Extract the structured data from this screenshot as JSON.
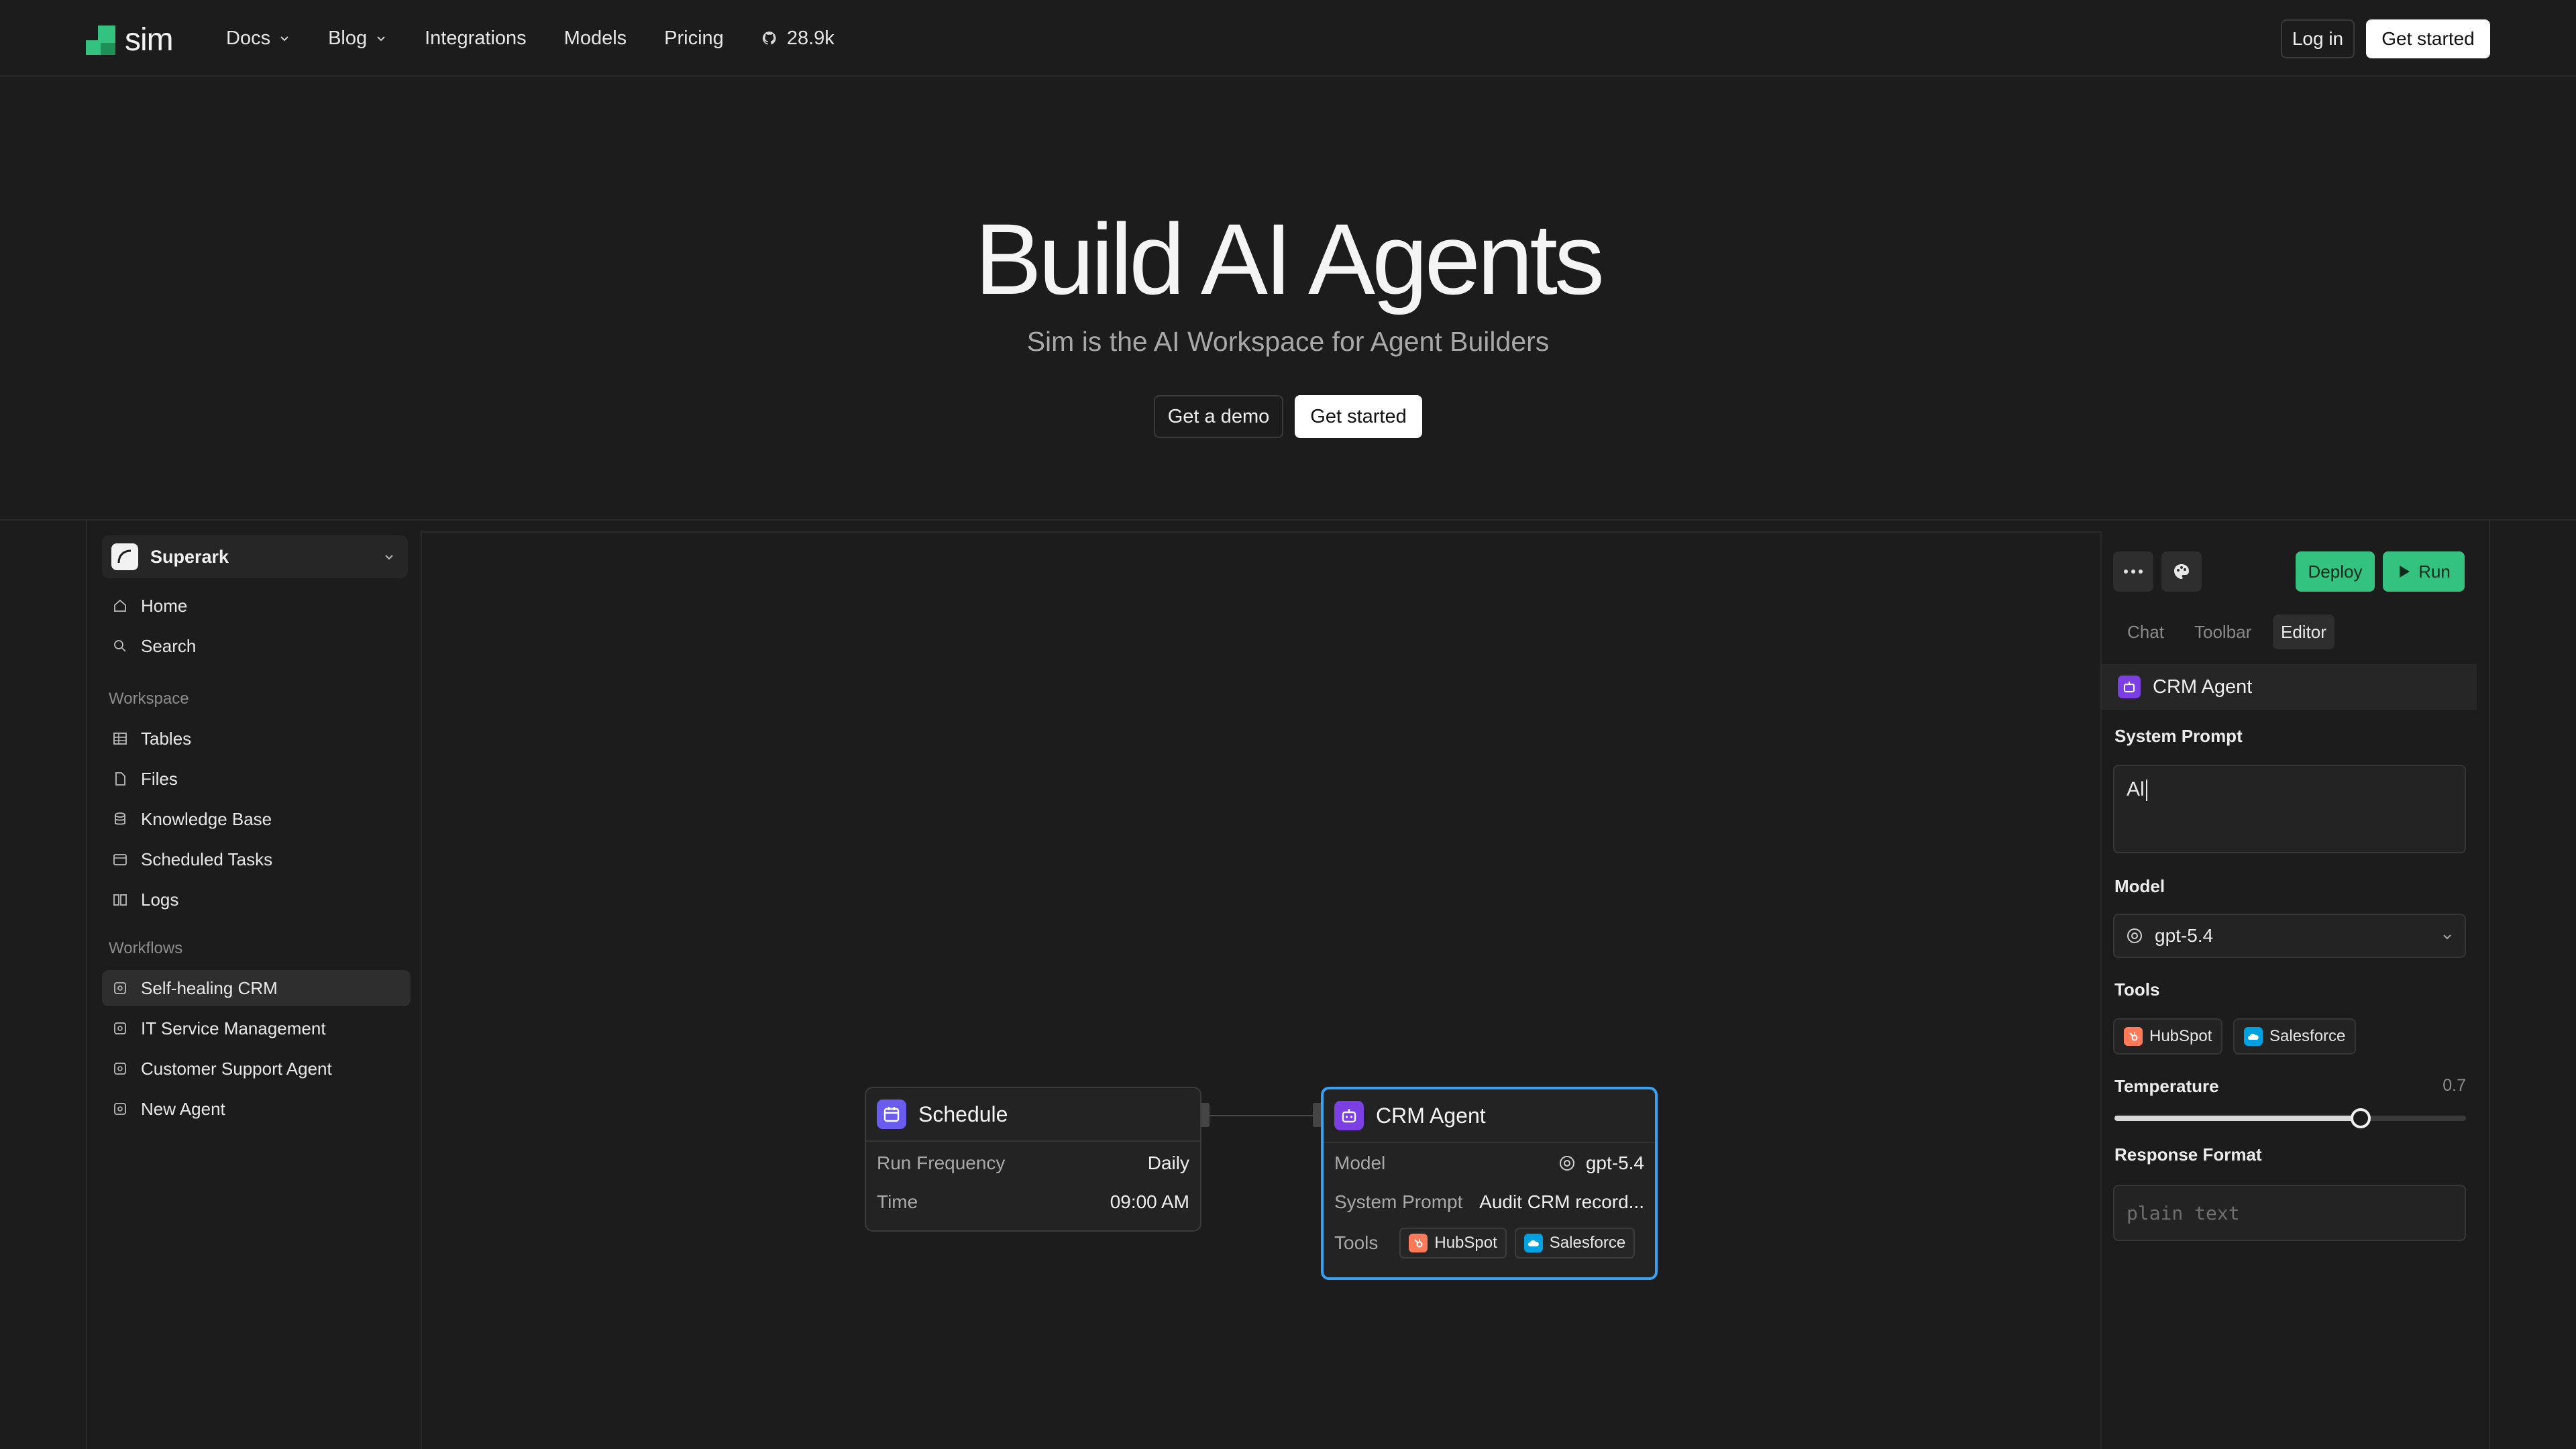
{
  "nav": {
    "logo_text": "sim",
    "links": [
      {
        "label": "Docs",
        "has_dropdown": true
      },
      {
        "label": "Blog",
        "has_dropdown": true
      },
      {
        "label": "Integrations"
      },
      {
        "label": "Models"
      },
      {
        "label": "Pricing"
      }
    ],
    "github_stars": "28.9k",
    "login_label": "Log in",
    "get_started_label": "Get started"
  },
  "hero": {
    "title": "Build AI Agents",
    "subtitle": "Sim is the AI Workspace for Agent Builders",
    "demo_label": "Get a demo",
    "start_label": "Get started"
  },
  "sidebar": {
    "workspace_name": "Superark",
    "top_items": [
      {
        "label": "Home",
        "icon": "home-icon"
      },
      {
        "label": "Search",
        "icon": "search-icon"
      }
    ],
    "workspace_section": "Workspace",
    "workspace_items": [
      {
        "label": "Tables",
        "icon": "table-icon"
      },
      {
        "label": "Files",
        "icon": "file-icon"
      },
      {
        "label": "Knowledge Base",
        "icon": "database-icon"
      },
      {
        "label": "Scheduled Tasks",
        "icon": "calendar-icon"
      },
      {
        "label": "Logs",
        "icon": "logs-icon"
      }
    ],
    "workflows_section": "Workflows",
    "workflows": [
      {
        "label": "Self-healing CRM",
        "active": true
      },
      {
        "label": "IT Service Management"
      },
      {
        "label": "Customer Support Agent"
      },
      {
        "label": "New Agent"
      }
    ]
  },
  "canvas": {
    "schedule_node": {
      "title": "Schedule",
      "rows": [
        {
          "label": "Run Frequency",
          "value": "Daily"
        },
        {
          "label": "Time",
          "value": "09:00 AM"
        }
      ]
    },
    "agent_node": {
      "title": "CRM Agent",
      "model_label": "Model",
      "model_value": "gpt-5.4",
      "prompt_label": "System Prompt",
      "prompt_value": "Audit CRM record...",
      "tools_label": "Tools",
      "tools": [
        "HubSpot",
        "Salesforce"
      ]
    }
  },
  "panel": {
    "deploy_label": "Deploy",
    "run_label": "Run",
    "tabs": [
      {
        "label": "Chat"
      },
      {
        "label": "Toolbar"
      },
      {
        "label": "Editor",
        "active": true
      }
    ],
    "block_name": "CRM Agent",
    "system_prompt_label": "System Prompt",
    "system_prompt_value": "Al",
    "model_label": "Model",
    "model_value": "gpt-5.4",
    "tools_label": "Tools",
    "tools": [
      "HubSpot",
      "Salesforce"
    ],
    "temperature_label": "Temperature",
    "temperature_value": "0.7",
    "temperature_fraction": 0.7,
    "response_format_label": "Response Format",
    "response_format_placeholder": "plain text"
  },
  "colors": {
    "background": "#1c1c1c",
    "accent_green": "#33c27f",
    "agent_purple": "#7b3fe4",
    "schedule_purple": "#6b5cf0",
    "selection_blue": "#3aa0f0",
    "hubspot": "#ff7a59",
    "salesforce": "#00a1e0"
  }
}
